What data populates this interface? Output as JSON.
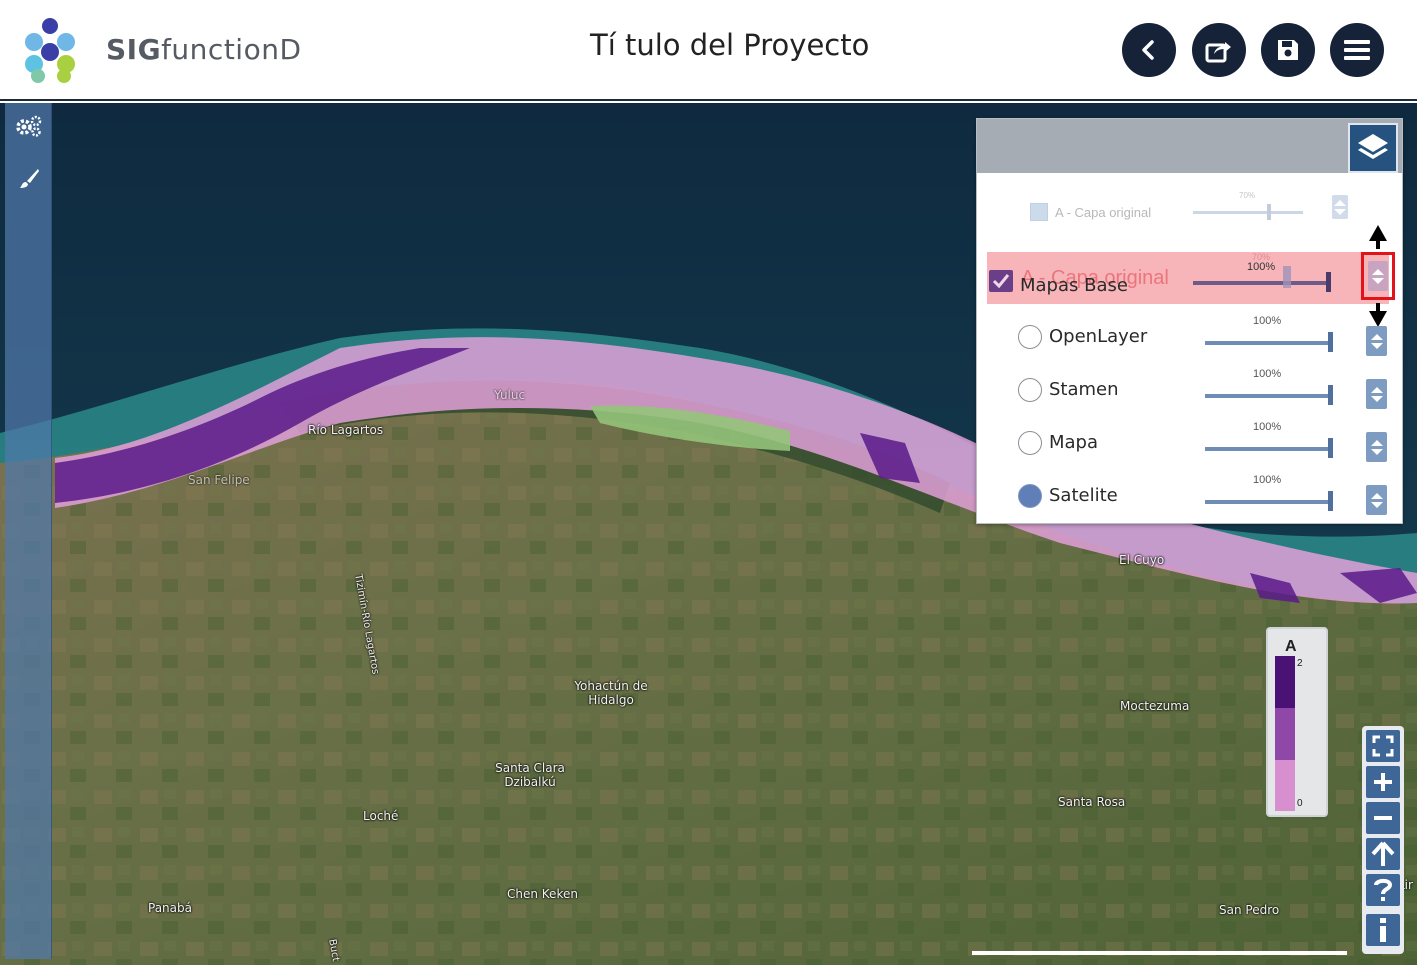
{
  "header": {
    "app_name_bold": "SIG",
    "app_name_rest": "functionD",
    "title": "Tí tulo del Proyecto",
    "buttons": [
      "back-icon",
      "share-icon",
      "save-icon",
      "menu-icon"
    ]
  },
  "leftbar": {
    "buttons": [
      "settings-icon",
      "brush-icon"
    ]
  },
  "map": {
    "places": [
      "Río Lagartos",
      "San Felipe",
      "Yuluc",
      "Tizimín-Río Lagartos",
      "Yohactún de Hidalgo",
      "Santa Clara Dzibalkú",
      "Loché",
      "Panabá",
      "Chen Keken",
      "El Cuyo",
      "Moctezuma",
      "Santa Rosa",
      "San Pedro",
      "Lir",
      "Buct"
    ]
  },
  "layer_panel": {
    "ghost_row": {
      "label": "A - Capa original",
      "percent": "70%",
      "opacity": 0.7
    },
    "dragging_row": {
      "label": "Mapas Base",
      "ghost_label": "A - Capa original",
      "percent": "100%",
      "overlay_percent": "70%",
      "opacity": 1.0,
      "checked": true
    },
    "base_layers": [
      {
        "label": "OpenLayer",
        "percent": "100%",
        "opacity": 1.0,
        "selected": false
      },
      {
        "label": "Stamen",
        "percent": "100%",
        "opacity": 1.0,
        "selected": false
      },
      {
        "label": "Mapa",
        "percent": "100%",
        "opacity": 1.0,
        "selected": false
      },
      {
        "label": "Satelite",
        "percent": "100%",
        "opacity": 1.0,
        "selected": true
      }
    ]
  },
  "legend": {
    "title": "A",
    "max": "2",
    "min": "0",
    "colors": [
      "#4a1275",
      "#9048a8",
      "#d88fd0"
    ]
  },
  "map_controls": [
    "fullscreen-icon",
    "zoom-in-icon",
    "zoom-out-icon",
    "north-arrow-icon",
    "help-icon",
    "info-icon"
  ],
  "colors": {
    "header_button": "#152238",
    "accent": "#3e6797",
    "highlight": "#f7b5b9",
    "drag_marker": "#e3131b"
  }
}
